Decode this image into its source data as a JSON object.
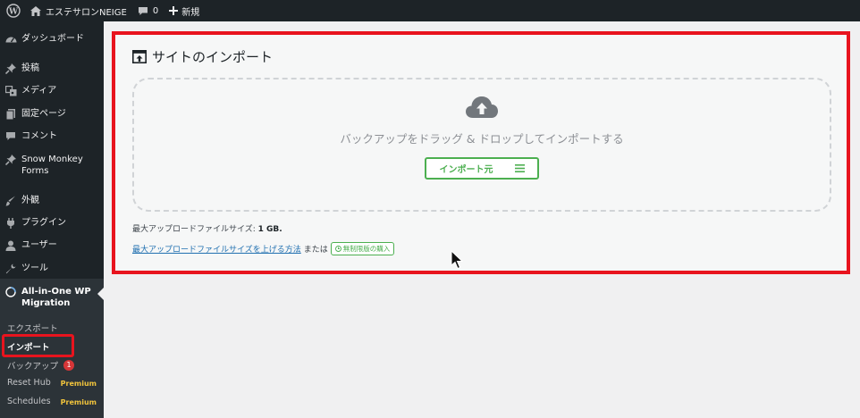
{
  "adminbar": {
    "site_name": "エステサロンNEIGE",
    "comments_count": "0",
    "new_label": "新規"
  },
  "sidebar": {
    "items": [
      {
        "label": "ダッシュボード",
        "icon": "dashboard-icon"
      },
      {
        "label": "投稿",
        "icon": "pin-icon"
      },
      {
        "label": "メディア",
        "icon": "media-icon"
      },
      {
        "label": "固定ページ",
        "icon": "page-icon"
      },
      {
        "label": "コメント",
        "icon": "comment-icon"
      },
      {
        "label": "Snow Monkey Forms",
        "icon": "pin-icon"
      },
      {
        "label": "外観",
        "icon": "appearance-icon"
      },
      {
        "label": "プラグイン",
        "icon": "plugin-icon"
      },
      {
        "label": "ユーザー",
        "icon": "user-icon"
      },
      {
        "label": "ツール",
        "icon": "wrench-icon"
      },
      {
        "label": "All-in-One WP Migration",
        "icon": "migration-icon"
      }
    ],
    "submenu": [
      {
        "label": "エクスポート"
      },
      {
        "label": "インポート"
      },
      {
        "label": "バックアップ",
        "badge": "1"
      },
      {
        "label": "Reset Hub",
        "tag": "Premium"
      },
      {
        "label": "Schedules",
        "tag": "Premium"
      }
    ]
  },
  "main": {
    "title": "サイトのインポート",
    "dropzone_text": "バックアップをドラッグ & ドロップしてインポートする",
    "import_button": "インポート元",
    "max_size_label": "最大アップロードファイルサイズ: ",
    "max_size_value": "1 GB.",
    "increase_link": "最大アップロードファイルサイズを上げる方法",
    "or_text": "または",
    "unlimited_label": "無制限版の購入"
  },
  "colors": {
    "highlight": "#e8141e",
    "accent_green": "#4caf50",
    "admin_dark": "#1d2327",
    "link": "#2271b1"
  }
}
